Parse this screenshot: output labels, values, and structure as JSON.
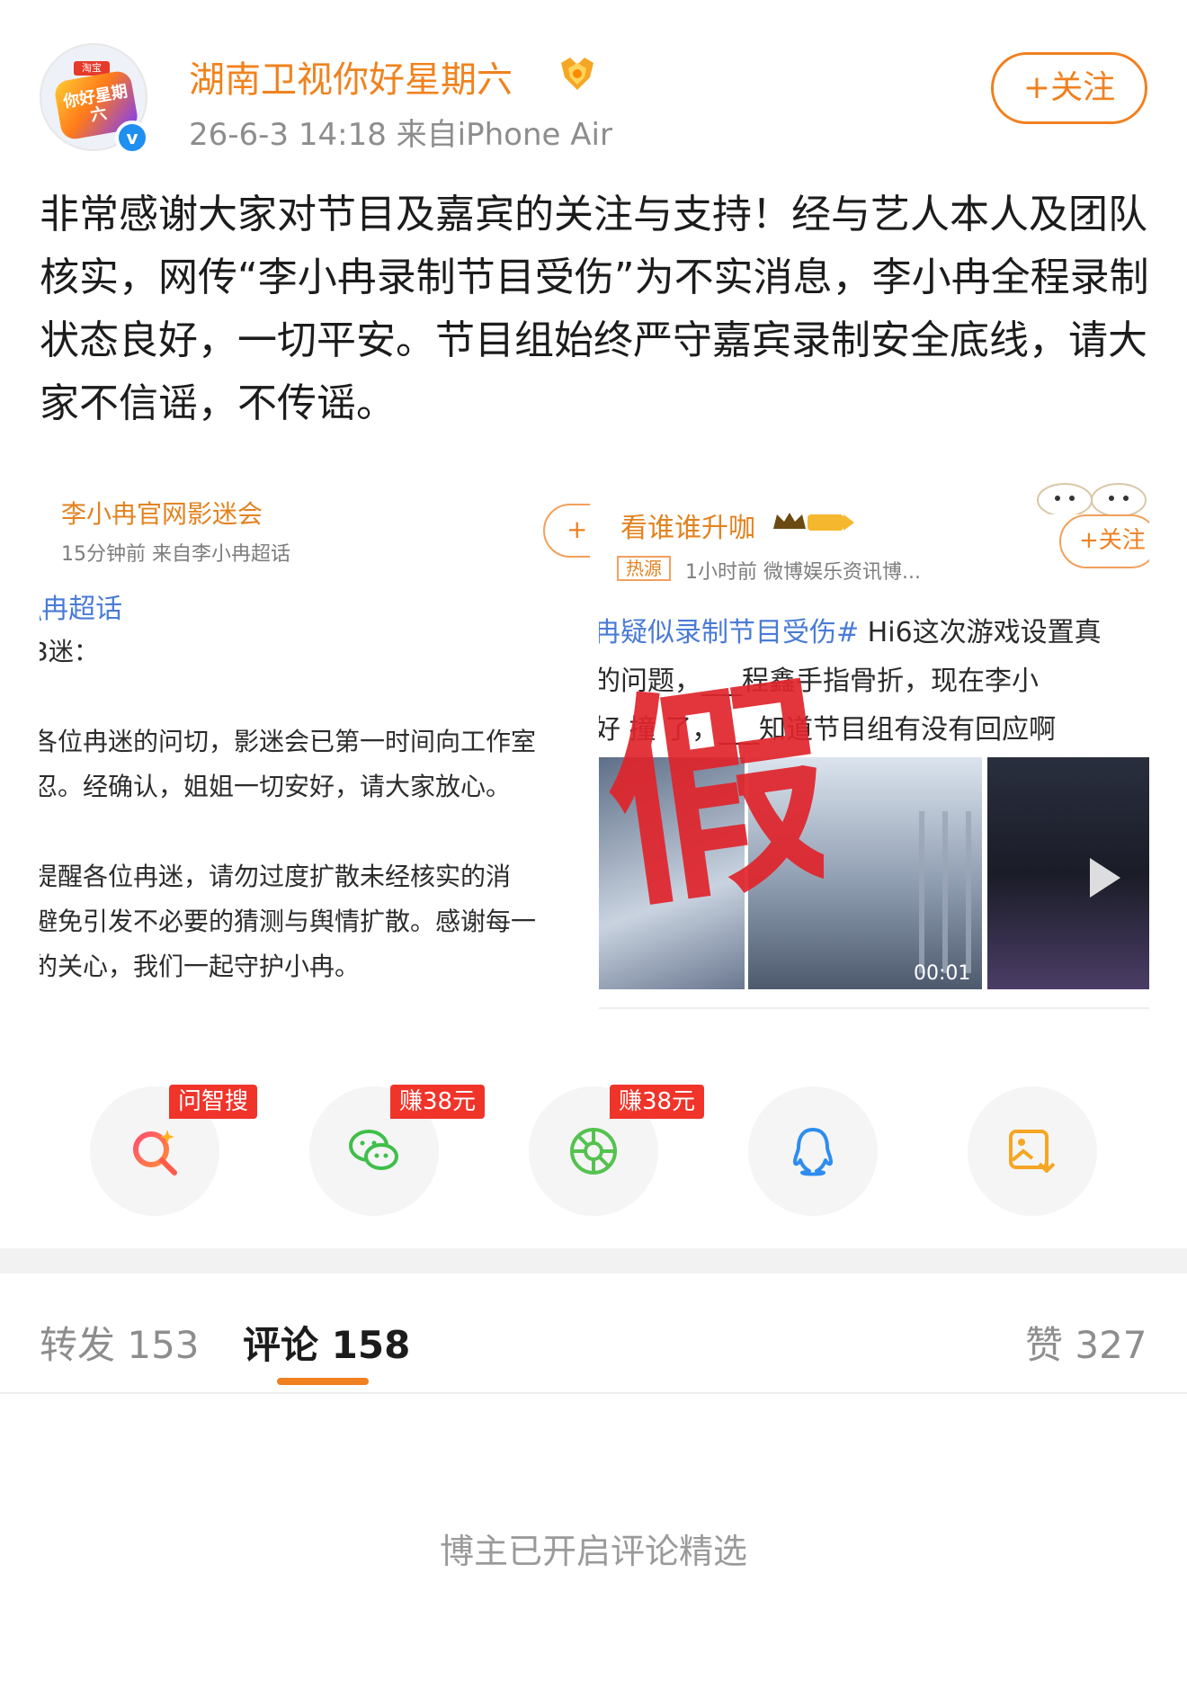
{
  "header": {
    "author": "湖南卫视你好星期六",
    "meta": "26-6-3 14:18  来自iPhone Air",
    "follow_label": "+关注",
    "avatar_tag": "淘宝",
    "avatar_text": "你好星期六"
  },
  "post": {
    "text": "非常感谢大家对节目及嘉宾的关注与支持！经与艺人本人及团队核实，网传“李小冉录制节目受伤”为不实消息，李小冉全程录制状态良好，一切平安。节目组始终严守嘉宾录制安全底线，请大家不信谣，不传谣。"
  },
  "embed_left": {
    "author": "李小冉官网影迷会",
    "meta": "15分钟前  来自李小冉超话",
    "follow_label": "+",
    "topic": "\\冉超话",
    "lines": [
      "3迷：",
      "",
      "各位冉迷的问切，影迷会已第一时间向工作室",
      "忍。经确认，姐姐一切安好，请大家放心。",
      "",
      "提醒各位冉迷，请勿过度扩散未经核实的消",
      "避免引发不必要的猜测与舆情扩散。感谢每一",
      "的关心，我们一起守护小冉。"
    ]
  },
  "embed_right": {
    "author": "看谁谁升咖",
    "hot_tag": "热源",
    "meta": "1小时前  微博娱乐资讯博...",
    "follow_label": "+关注",
    "line1_tag": "冉疑似录制节目受伤#",
    "line1_rest": " Hi6这次游戏设置真",
    "line2": "的问题，___程鑫手指骨折，现在李小",
    "line3": "好 撞 了，___知道节目组有没有回应啊",
    "stamp_text": "假",
    "duration": "00:01"
  },
  "share": {
    "items": [
      {
        "name": "search",
        "badge": "问智搜"
      },
      {
        "name": "wechat",
        "badge": "赚38元"
      },
      {
        "name": "moments",
        "badge": "赚38元"
      },
      {
        "name": "qq",
        "badge": ""
      },
      {
        "name": "save-image",
        "badge": ""
      }
    ]
  },
  "tabs": {
    "repost": "转发 153",
    "comment": "评论 158",
    "like": "赞 327"
  },
  "notice": "博主已开启评论精选",
  "colors": {
    "accent": "#f08020",
    "badge": "#f0342a",
    "verified": "#1f8ff0"
  }
}
